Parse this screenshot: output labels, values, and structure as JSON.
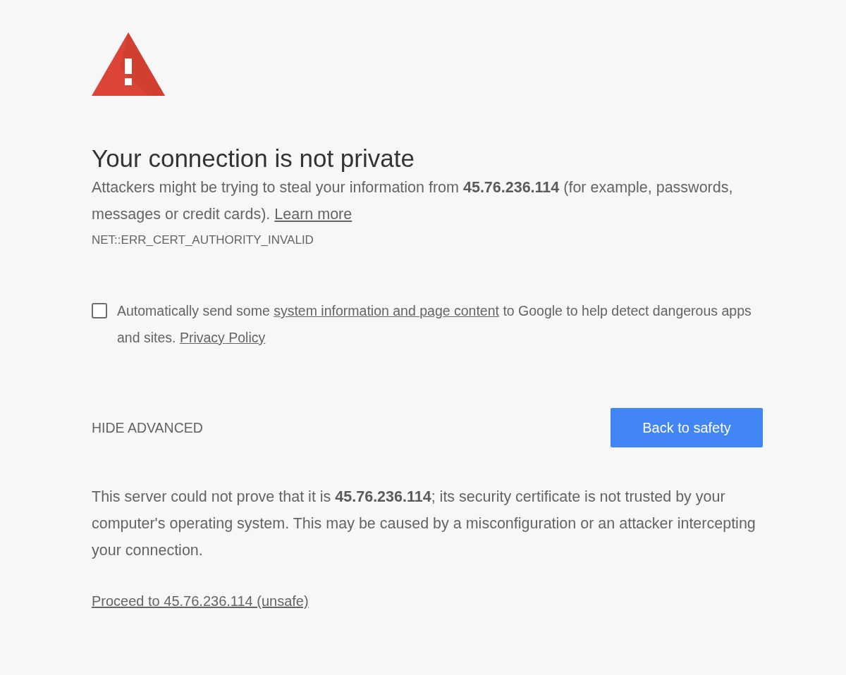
{
  "title": "Your connection is not private",
  "intro": [
    {
      "kind": "text",
      "text": "Attackers might be trying to steal your information from **45.76.236.114** (for example, passwords, messages or credit cards). "
    },
    {
      "kind": "link",
      "text": "Learn more"
    }
  ],
  "error_code": "NET::ERR_CERT_AUTHORITY_INVALID",
  "report": {
    "checked": false,
    "segments": [
      {
        "kind": "text",
        "text": "Automatically send some "
      },
      {
        "kind": "link",
        "text": "system information and page content"
      },
      {
        "kind": "text",
        "text": " to Google to help detect dangerous apps and sites. "
      },
      {
        "kind": "link",
        "text": "Privacy Policy"
      }
    ]
  },
  "advanced_button": "HIDE ADVANCED",
  "primary_button": "Back to safety",
  "details": [
    {
      "kind": "text",
      "text": "This server could not prove that it is **45.76.236.114**; its security certificate is not trusted by your computer's operating system. This may be caused by a misconfiguration or an attacker intercepting your connection."
    }
  ],
  "proceed_link": "Proceed to 45.76.236.114 (unsafe)"
}
